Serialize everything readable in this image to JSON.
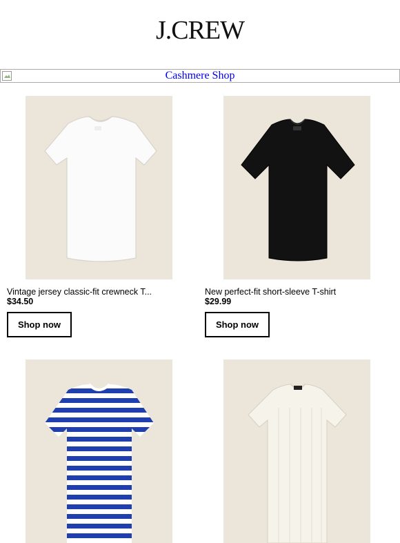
{
  "header": {
    "logo": "J.CREW"
  },
  "banner": {
    "alt_text": "Cashmere Shop"
  },
  "products": [
    {
      "name": "Vintage jersey classic-fit crewneck T...",
      "price": "$34.50",
      "cta": "Shop now",
      "color": "#ffffff"
    },
    {
      "name": "New perfect-fit short-sleeve T-shirt",
      "price": "$29.99",
      "cta": "Shop now",
      "color": "#111111"
    },
    {
      "name": "",
      "price": "",
      "cta": "",
      "color": "#1f3fae"
    },
    {
      "name": "",
      "price": "",
      "cta": "",
      "color": "#f6f3ea"
    }
  ],
  "colors": {
    "photo_bg": "#ece5d9",
    "link": "#0000ee"
  }
}
